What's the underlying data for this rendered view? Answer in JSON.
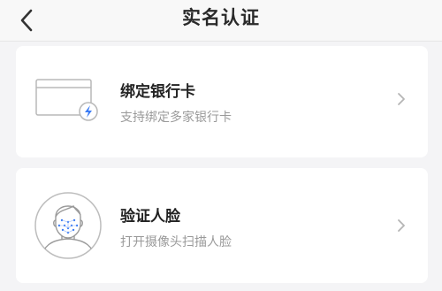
{
  "header": {
    "title": "实名认证",
    "back_icon": "chevron-left-icon"
  },
  "cards": [
    {
      "title": "绑定银行卡",
      "subtitle": "支持绑定多家银行卡",
      "icon": "bank-card-icon"
    },
    {
      "title": "验证人脸",
      "subtitle": "打开摄像头扫描人脸",
      "icon": "face-scan-icon"
    }
  ],
  "colors": {
    "background": "#f4f4f6",
    "card": "#ffffff",
    "accent": "#3b7cf5",
    "title": "#222222",
    "subtitle": "#9a9a9a"
  }
}
